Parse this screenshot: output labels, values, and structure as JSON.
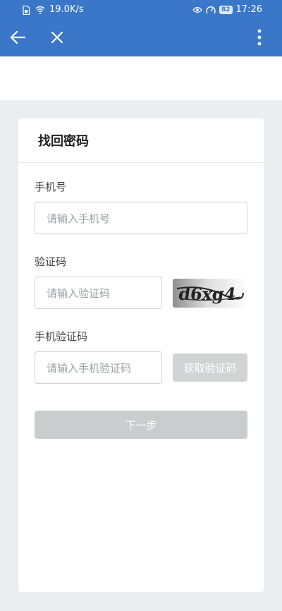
{
  "status_bar": {
    "net_speed": "19.0K/s",
    "battery": "82",
    "time": "17:26",
    "icons": [
      "sim-icon",
      "wifi-icon",
      "eye-icon",
      "speedometer-icon"
    ]
  },
  "app_bar": {
    "back_icon": "arrow-left-icon",
    "close_icon": "close-icon",
    "more_icon": "more-vertical-icon",
    "color": "#3a77c9"
  },
  "form": {
    "title": "找回密码",
    "phone": {
      "label": "手机号",
      "placeholder": "请输入手机号"
    },
    "captcha": {
      "label": "验证码",
      "placeholder": "请输入验证码",
      "image_text": "d6xg4"
    },
    "sms": {
      "label": "手机验证码",
      "placeholder": "请输入手机验证码",
      "button": "获取验证码"
    },
    "next_button": "下一步"
  }
}
